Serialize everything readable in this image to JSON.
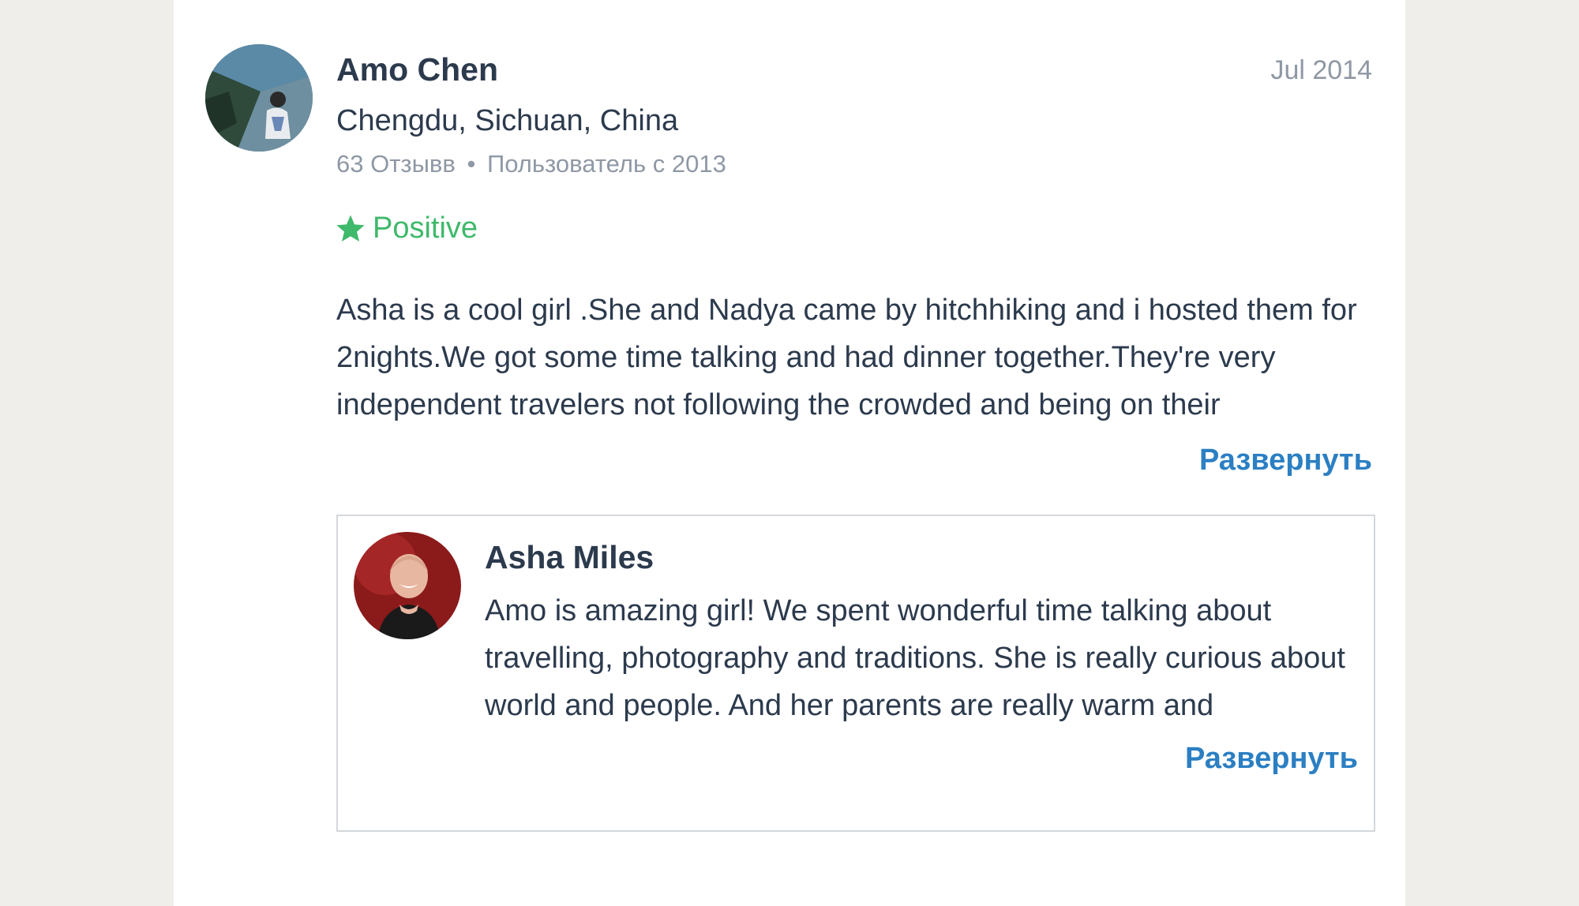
{
  "review": {
    "author": "Amo Chen",
    "date": "Jul 2014",
    "location": "Chengdu, Sichuan, China",
    "reviews_count": "63 Отзывв",
    "separator": "•",
    "member_since": "Пользователь с 2013",
    "rating_label": "Positive",
    "text": "Asha is a cool girl .She and Nadya came by hitchhiking and i hosted them for 2nights.We got some time talking and had dinner together.They're very independent travelers not following the crowded and being on their",
    "expand_label": "Развернуть"
  },
  "reply": {
    "author": "Asha Miles",
    "text": "Amo is amazing girl! We spent wonderful time talking about travelling, photography and traditions. She is really curious about world and people. And her parents are really warm and",
    "expand_label": "Развернуть"
  },
  "icons": {
    "rating": "star-icon"
  },
  "colors": {
    "positive": "#3fb96b",
    "link": "#2b7fc3",
    "muted": "#8f98a5",
    "text": "#2c3a4d",
    "page_background": "#efeeea"
  }
}
